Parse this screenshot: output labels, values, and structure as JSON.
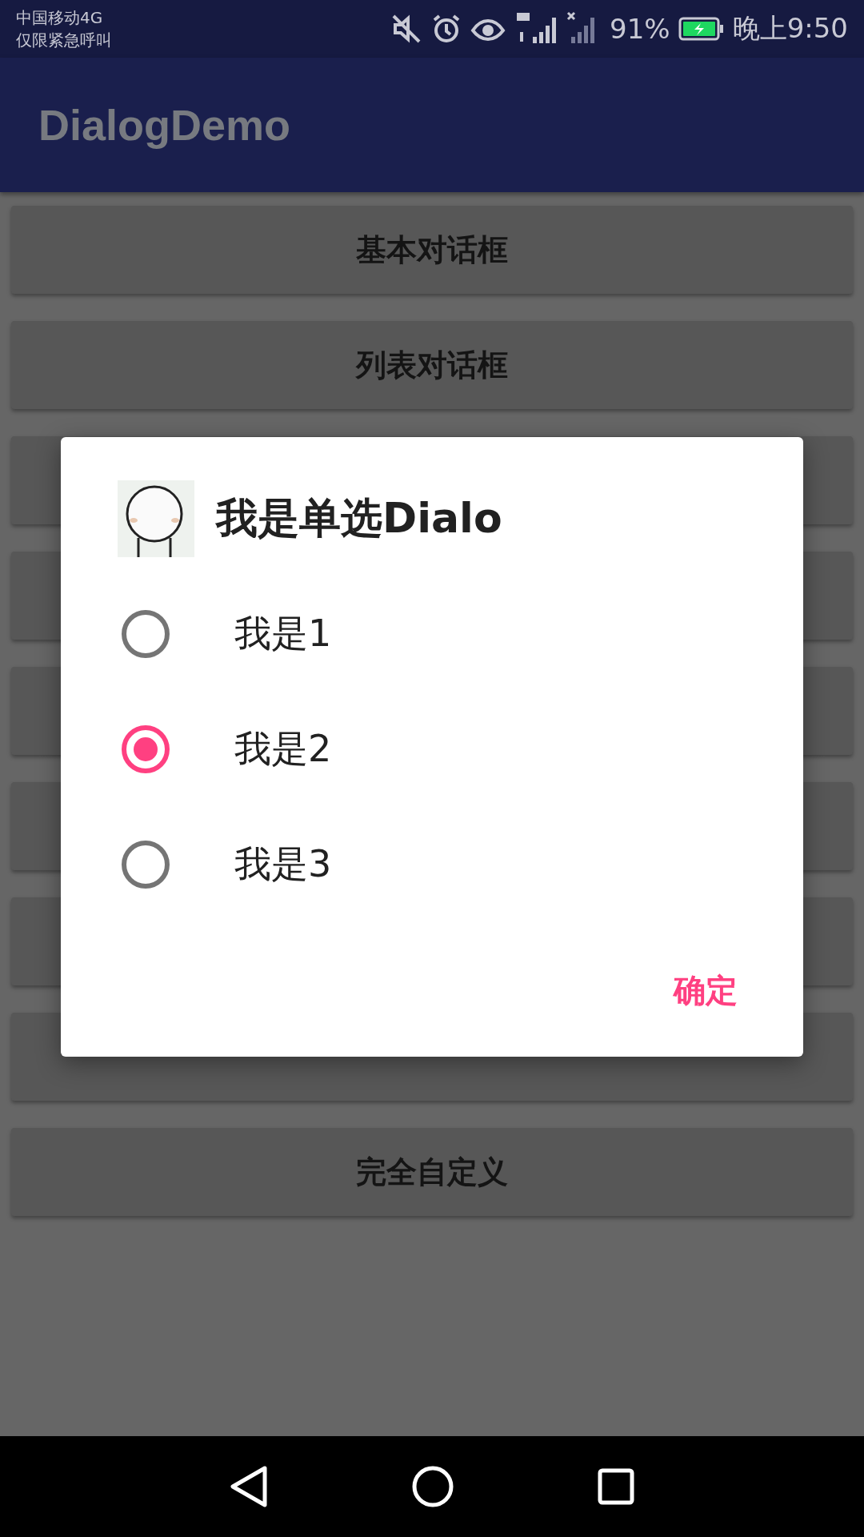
{
  "status_bar": {
    "carrier": "中国移动4G",
    "emergency": "仅限紧急呼叫",
    "battery_percent": "91%",
    "time": "晚上9:50"
  },
  "app_bar": {
    "title": "DialogDemo"
  },
  "buttons": [
    {
      "kind": "labeled",
      "label": "基本对话框"
    },
    {
      "kind": "labeled",
      "label": "列表对话框"
    },
    {
      "kind": "covered"
    },
    {
      "kind": "covered"
    },
    {
      "kind": "covered"
    },
    {
      "kind": "covered"
    },
    {
      "kind": "covered"
    },
    {
      "kind": "covered"
    },
    {
      "kind": "labeled",
      "label": "完全自定义"
    }
  ],
  "dialog": {
    "title": "我是单选Dialo",
    "options": [
      {
        "label": "我是1",
        "selected": false
      },
      {
        "label": "我是2",
        "selected": true
      },
      {
        "label": "我是3",
        "selected": false
      }
    ],
    "positive_button": "确定"
  }
}
